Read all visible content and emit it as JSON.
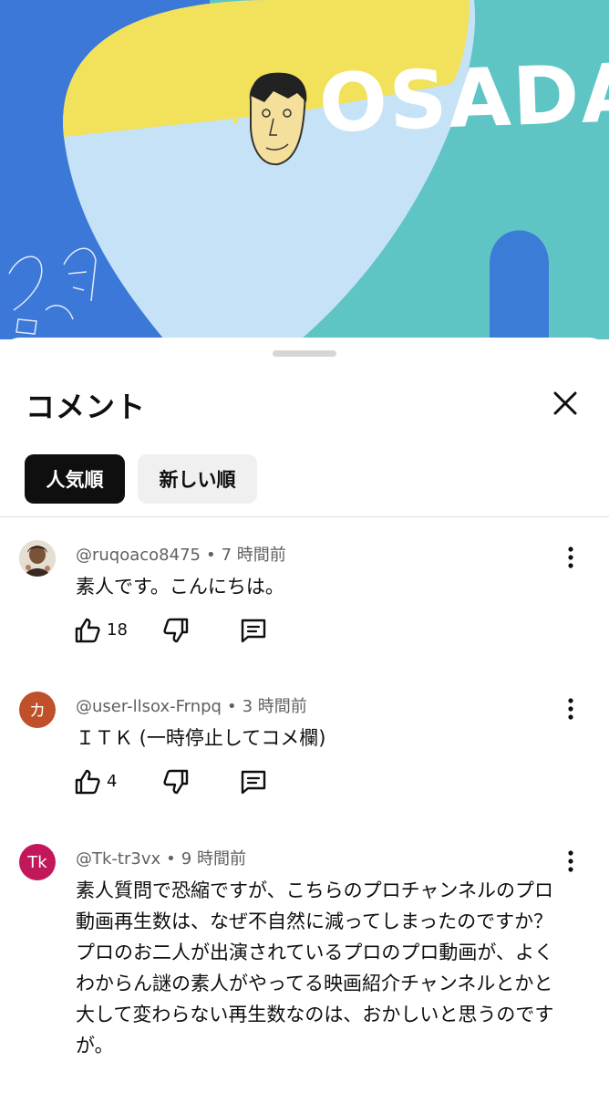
{
  "video": {
    "title_text": "OSADA"
  },
  "sheet": {
    "title": "コメント",
    "filters": [
      {
        "label": "人気順",
        "selected": true
      },
      {
        "label": "新しい順",
        "selected": false
      }
    ]
  },
  "comments": [
    {
      "author": "@ruqoaco8475",
      "time": "7 時間前",
      "text": "素人です。こんにちは。",
      "likes": "18",
      "avatar_color": "#8a6a55"
    },
    {
      "author": "@user-llsox-Frnpq",
      "time": "3 時間前",
      "text": "ＩＴＫ (一時停止してコメ欄)",
      "likes": "4",
      "avatar_letter": "カ",
      "avatar_color": "#c0502a"
    },
    {
      "author": "@Tk-tr3vx",
      "time": "9 時間前",
      "text": "素人質問で恐縮ですが、こちらのプロチャンネルのプロ動画再生数は、なぜ不自然に減ってしまったのですか？\nプロのお二人が出演されているプロのプロ動画が、よくわからん謎の素人がやってる映画紹介チャンネルとかと大して変わらない再生数なのは、おかしいと思うのですが。",
      "likes": "",
      "avatar_letter": "Tk",
      "avatar_color": "#c2185b"
    }
  ],
  "colors": {
    "accent_dark": "#0f0f0f",
    "chip_inactive": "#f0f0f0",
    "meta_text": "#606060"
  }
}
